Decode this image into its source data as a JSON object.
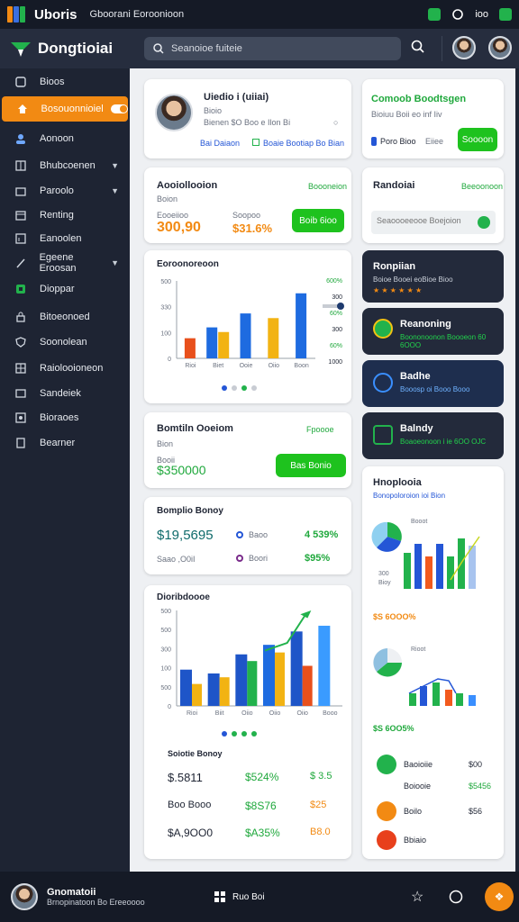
{
  "top": {
    "app_title": "Uboris",
    "app_subtitle": "Gboorani Eoroonioon",
    "right_text": "ioo"
  },
  "header": {
    "brand": "Dongtioiai",
    "search_placeholder": "Seanoioe fuiteie"
  },
  "sidebar": {
    "items": [
      {
        "label": "Bioos",
        "icon": "dashboard-icon"
      },
      {
        "label": "Bosouonnioiel",
        "icon": "toggle-icon",
        "active": true
      },
      {
        "label": "Aonoon",
        "icon": "users-icon"
      },
      {
        "label": "Bhubcoenen",
        "icon": "grid-icon",
        "chevron": true
      },
      {
        "label": "Paroolo",
        "icon": "folder-icon",
        "chevron": true
      },
      {
        "label": "Renting",
        "icon": "calendar-icon"
      },
      {
        "label": "Eanoolen",
        "icon": "chart-icon"
      },
      {
        "label": "Egeene Eroosan",
        "icon": "pen-icon",
        "chevron": true
      },
      {
        "label": "Dioppar",
        "icon": "gift-icon"
      },
      {
        "label": "Bitoeonoed",
        "icon": "lock-icon"
      },
      {
        "label": "Soonolean",
        "icon": "shield-icon"
      },
      {
        "label": "Raiolooioneon",
        "icon": "table-icon"
      },
      {
        "label": "Sandeiek",
        "icon": "image-icon"
      },
      {
        "label": "Bioraoes",
        "icon": "photo-icon"
      },
      {
        "label": "Bearner",
        "icon": "doc-icon"
      }
    ]
  },
  "profile": {
    "name": "Uiedio i (uiiai)",
    "sub": "Bioio",
    "meta": "Bienen $O  Boo e Ilon Bi",
    "link1": "Bai Daiaon",
    "link2": "Boaie Bootiap Bo Bian"
  },
  "connect": {
    "title": "Comoob Boodtsgen",
    "sub": "Bioiuu Boii eo inf Iiv",
    "field_label": "Poro  Bioo",
    "field_value": "Eiiee",
    "button": "Soooon"
  },
  "accounts": {
    "title": "Aooiollooion",
    "sub": "Boion",
    "link": "Boooneion",
    "l1": "Eooeiioo",
    "v1": "300,90",
    "l2": "Soopoo",
    "v2": "$31.6%",
    "button": "Boib 6ioo"
  },
  "random": {
    "title": "Randoiai",
    "link": "Beeoonoon",
    "input_placeholder": "Seaoooeeooe Boejoion"
  },
  "earnings": {
    "title": "Eoroonoreoon",
    "ylabels": [
      "500",
      "330",
      "100",
      "0"
    ],
    "xlabels": [
      "Rioi",
      "Biet",
      "Ooie",
      "Oiio",
      "Boon"
    ],
    "side_labels": [
      "600%",
      "300",
      "60%",
      "300",
      "60%",
      "1000"
    ]
  },
  "dark_cards": [
    {
      "title": "Ronpiian",
      "sub": "Boioe Booei eoBioe Bioo",
      "stars": "★ ★ ★ ★ ★ ★"
    },
    {
      "title": "Reanoning",
      "sub": "Boononoonon Boooeon 60 6OOO"
    },
    {
      "title": "Badhe",
      "sub": "Booosp oi Booo Booo"
    },
    {
      "title": "Balndy",
      "sub": "Boaoeonoon i ie 6OO OJC"
    }
  ],
  "balance": {
    "title": "Bomtiln Ooeiom",
    "sub": "Bion",
    "link": "Fpoooe",
    "label": "Booii",
    "value": "$350000",
    "button": "Bas Bonio"
  },
  "summary": {
    "title": "Bomplio Bonoy",
    "v1": "$19,5695",
    "l1": "Baoo",
    "p1": "4 539%",
    "v2": "Saao ,O0iI",
    "l2": "Boori",
    "p2": "$95%"
  },
  "analysis": {
    "title": "Dioribdoooe",
    "ylabels": [
      "500",
      "500",
      "300",
      "100",
      "500",
      "0"
    ],
    "xlabels": [
      "Rioi",
      "Biit",
      "Oiio",
      "Oiio",
      "Oiio",
      "Booo"
    ]
  },
  "subsummary": {
    "title": "Soiotie Bonoy",
    "rows": [
      {
        "a": "$.5811",
        "b": "$524%",
        "c": "$ 3.5"
      },
      {
        "a": "Boo  Booo",
        "b": "$8S76",
        "c": "$25"
      },
      {
        "a": "$A,9OO0",
        "b": "$A35%",
        "c": "B8.0"
      }
    ]
  },
  "right_panel": {
    "title": "Hnoplooia",
    "sub": "Bonopoloroion ioi Bion",
    "chart1_label": "Booot",
    "chart1_ylabels": [
      "300",
      "200",
      "Bioy"
    ],
    "chart1_total": "$S 6OOO%",
    "chart2_label": "Rioot",
    "chart2_ylabels": [
      "Doo",
      "Biyy"
    ],
    "chart2_total": "$S 6OO5%",
    "items": [
      {
        "label": "Baoioiie",
        "value": "$00"
      },
      {
        "label": "Boiooie",
        "value": "$5456"
      },
      {
        "label": "Boilo",
        "value": "$56"
      },
      {
        "label": "Bbiaio",
        "value": ""
      }
    ]
  },
  "bottom": {
    "name": "Gnomatoii",
    "sub": "Brnopinatoon Bo Ereeoooo",
    "center": "Ruo  Boi"
  },
  "chart_data": [
    {
      "type": "bar",
      "title": "Eoroonoreoon",
      "categories": [
        "Rioi",
        "Biet",
        "Ooie",
        "Oiio",
        "Boon"
      ],
      "series": [
        {
          "values": [
            130,
            0,
            0,
            0,
            0
          ]
        },
        {
          "values": [
            0,
            200,
            290,
            0,
            420
          ]
        },
        {
          "values": [
            0,
            170,
            0,
            260,
            0
          ]
        }
      ],
      "ylim": [
        0,
        500
      ]
    },
    {
      "type": "bar",
      "title": "Dioribdoooe",
      "categories": [
        "Rioi",
        "Biit",
        "Oiio",
        "Oiio",
        "Oiio",
        "Booo"
      ],
      "series": [
        {
          "values": [
            190,
            170,
            270,
            320,
            390,
            420
          ]
        },
        {
          "values": [
            115,
            150,
            235,
            280,
            210,
            0
          ]
        }
      ],
      "ylim": [
        0,
        500
      ]
    }
  ]
}
